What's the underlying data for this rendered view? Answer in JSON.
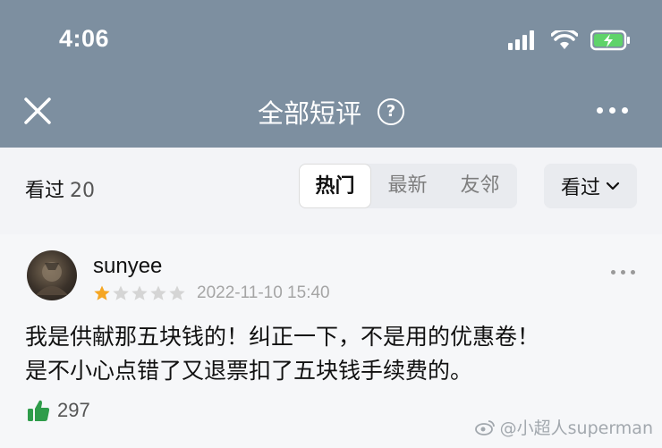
{
  "status_bar": {
    "time": "4:06"
  },
  "nav": {
    "title": "全部短评"
  },
  "filter": {
    "seen_label": "看过",
    "seen_count": "20",
    "tabs": [
      "热门",
      "最新",
      "友邻"
    ],
    "active_tab": "热门",
    "dropdown_label": "看过"
  },
  "review": {
    "username": "sunyee",
    "rating_stars": 1,
    "rating_max": 5,
    "date": "2022-11-10 15:40",
    "text_line1": "我是供献那五块钱的！纠正一下，不是用的优惠卷！",
    "text_line2": "是不小心点错了又退票扣了五块钱手续费的。",
    "likes": "297"
  },
  "watermark": "@小超人superman",
  "colors": {
    "header_bg": "#7d8fa0",
    "like_green": "#2e9c4a",
    "star_orange": "#f5a623",
    "star_gray": "#d5d5d5"
  }
}
